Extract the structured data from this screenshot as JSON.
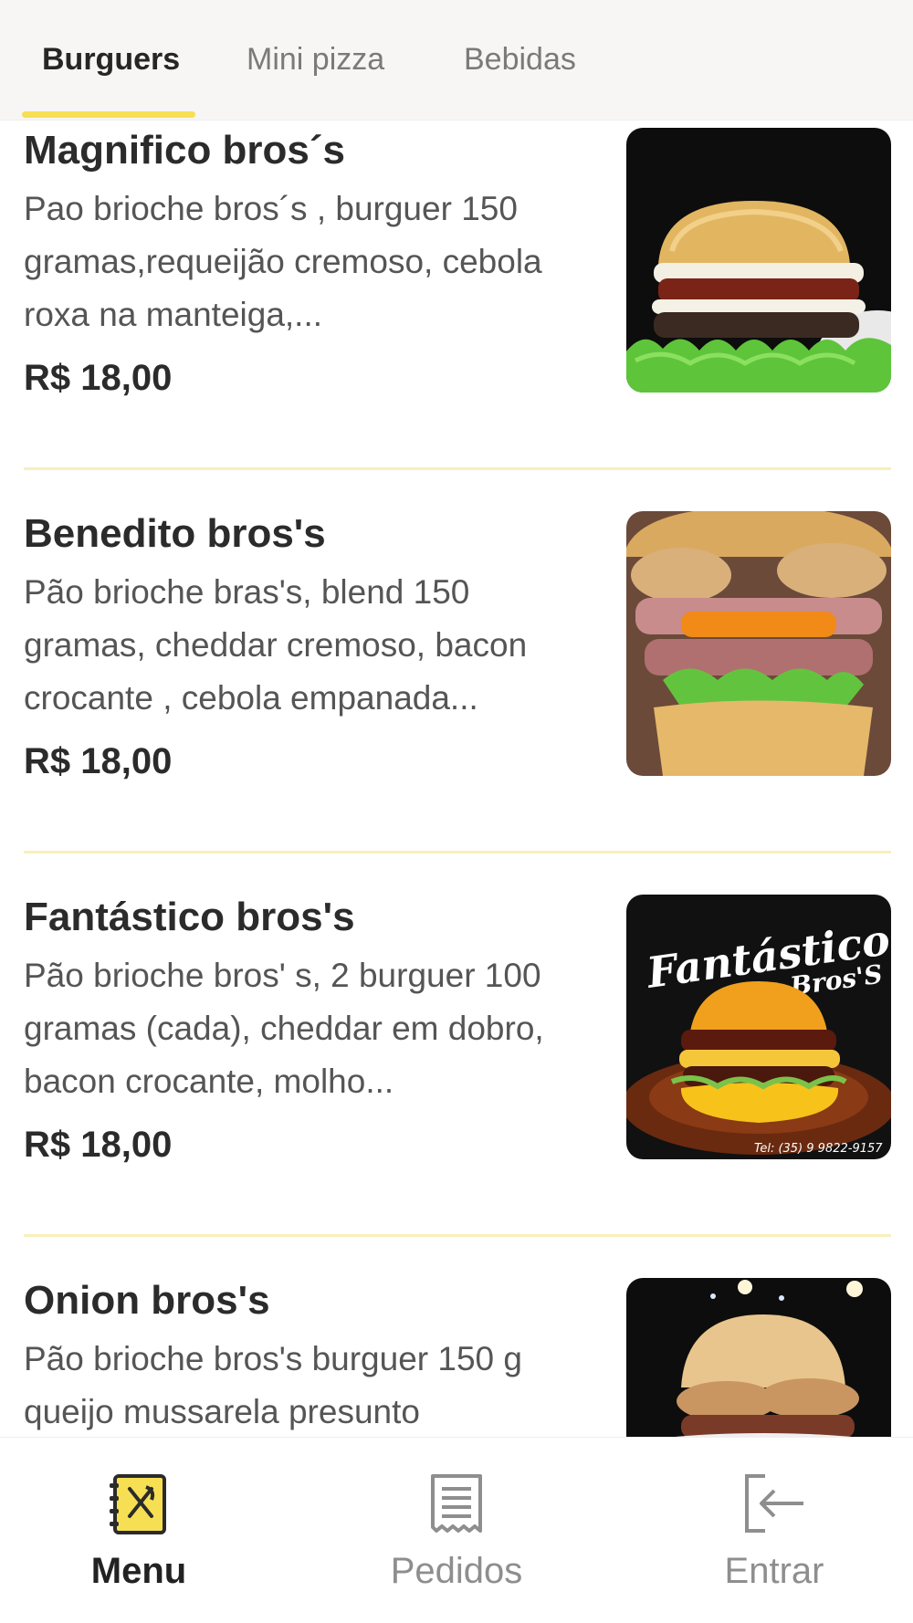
{
  "tabs": [
    {
      "label": "Burguers",
      "active": true
    },
    {
      "label": "Mini pizza",
      "active": false
    },
    {
      "label": "Bebidas",
      "active": false
    }
  ],
  "products": [
    {
      "name": "Magnifico bros´s",
      "description": "Pao brioche bros´s , burguer 150 gramas,requeijão cremoso, cebola roxa na manteiga,...",
      "price": "R$ 18,00",
      "image": "burger-photo"
    },
    {
      "name": "Benedito bros's",
      "description": "Pão brioche bras's, blend 150 gramas, cheddar cremoso, bacon crocante , cebola empanada...",
      "price": "R$ 18,00",
      "image": "burger-photo"
    },
    {
      "name": "Fantástico bros's",
      "description": "Pão brioche bros' s, 2 burguer 100 gramas (cada), cheddar em dobro, bacon crocante, molho...",
      "price": "R$ 18,00",
      "image": "burger-poster",
      "image_text": {
        "line1": "Fantástico",
        "line2": "Bros'S",
        "phone": "Tel: (35) 9 9822-9157"
      }
    },
    {
      "name": "Onion bros's",
      "description": "Pão brioche bros's burguer 150 g queijo mussarela presunto",
      "price": "",
      "image": "burger-photo"
    }
  ],
  "bottom_nav": [
    {
      "label": "Menu",
      "icon": "menu-book-icon",
      "active": true
    },
    {
      "label": "Pedidos",
      "icon": "receipt-icon",
      "active": false
    },
    {
      "label": "Entrar",
      "icon": "login-icon",
      "active": false
    }
  ],
  "colors": {
    "accent": "#f7df53",
    "divider": "#f8efbc",
    "text_dark": "#2b2b2b",
    "text_muted": "#555555",
    "nav_inactive": "#8e8e8e"
  }
}
